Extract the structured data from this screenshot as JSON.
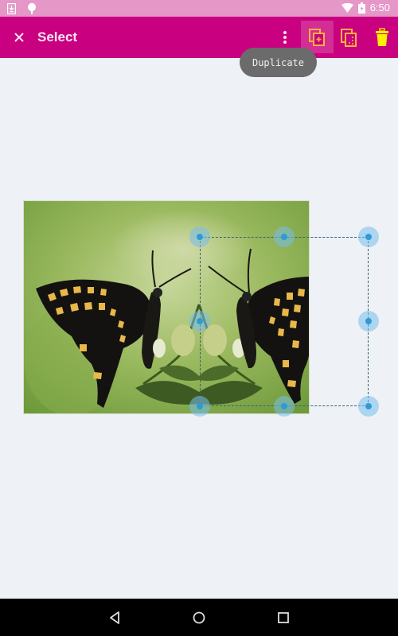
{
  "status_bar": {
    "time": "6:50",
    "left_icons": [
      "download-notification-icon",
      "android-debug-icon"
    ],
    "right_icons": [
      "wifi-icon",
      "battery-icon"
    ]
  },
  "app_bar": {
    "title": "Select",
    "background": "#c9007f",
    "actions": [
      {
        "name": "close",
        "icon": "close-icon"
      },
      {
        "name": "more-options",
        "icon": "more-vert-icon"
      },
      {
        "name": "duplicate",
        "icon": "duplicate-icon",
        "active": true
      },
      {
        "name": "copy",
        "icon": "copy-icon"
      },
      {
        "name": "delete",
        "icon": "delete-icon"
      }
    ]
  },
  "tooltip": {
    "text": "Duplicate"
  },
  "canvas": {
    "image_description": "Mirrored black swallowtail butterflies on green flower background",
    "selection_handles": 8
  },
  "nav_bar": {
    "buttons": [
      "back",
      "home",
      "recents"
    ]
  }
}
